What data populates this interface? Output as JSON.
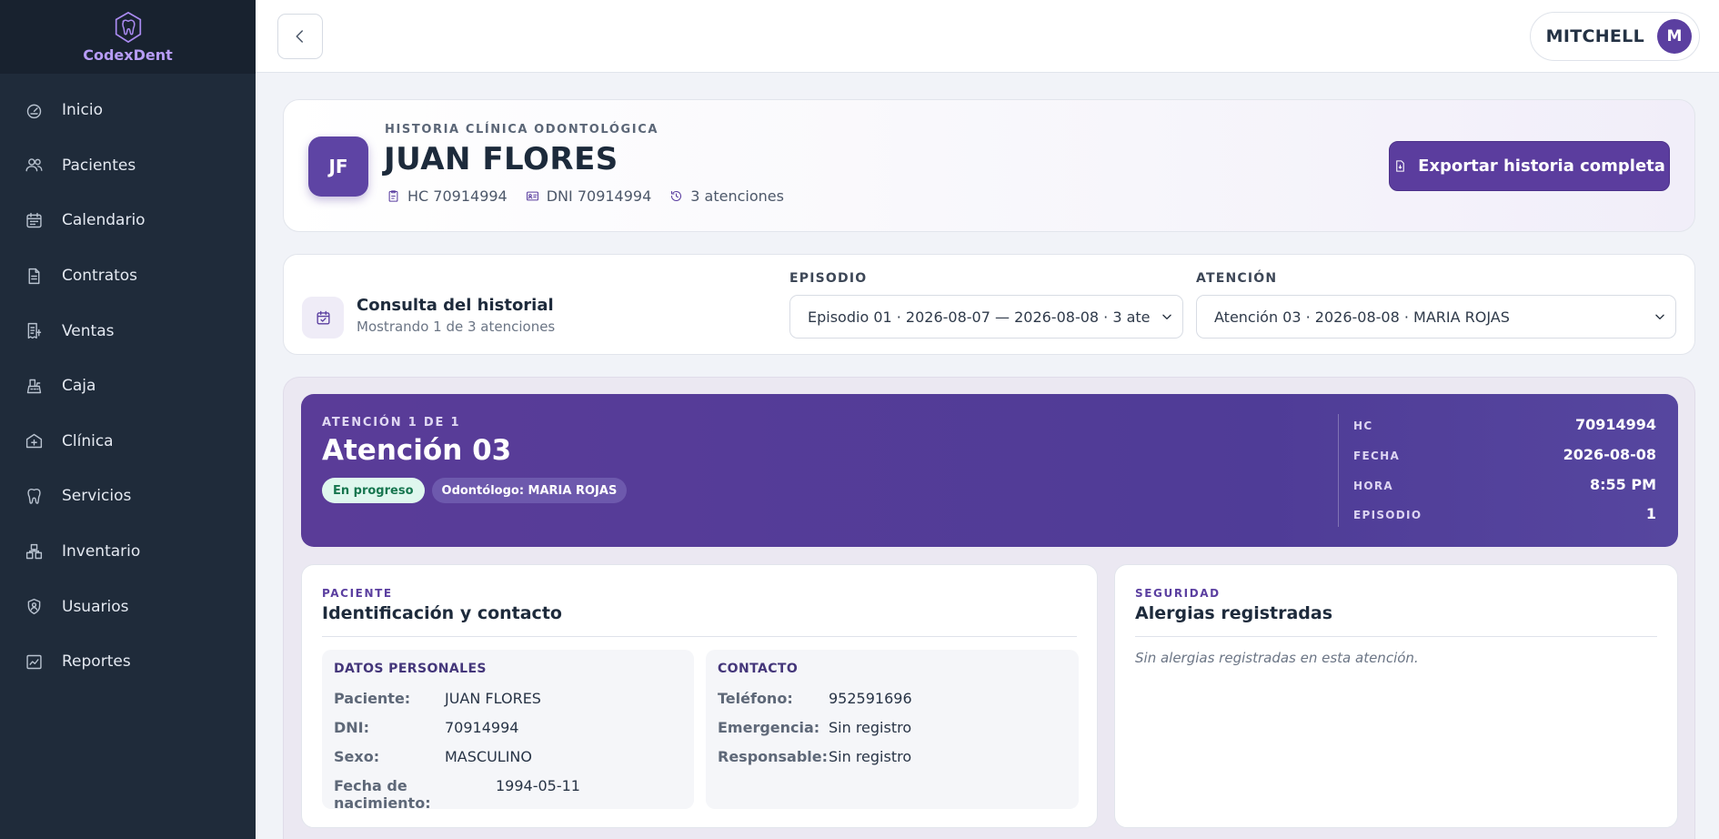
{
  "brand": {
    "name": "CodexDent",
    "logo_icon": "tooth-icon",
    "accent": "#b79cf5"
  },
  "sidebar": {
    "items": [
      {
        "label": "Inicio",
        "icon": "gauge-icon"
      },
      {
        "label": "Pacientes",
        "icon": "users-icon"
      },
      {
        "label": "Calendario",
        "icon": "calendar-icon"
      },
      {
        "label": "Contratos",
        "icon": "document-icon"
      },
      {
        "label": "Ventas",
        "icon": "receipt-icon"
      },
      {
        "label": "Caja",
        "icon": "cash-register-icon"
      },
      {
        "label": "Clínica",
        "icon": "clinic-icon"
      },
      {
        "label": "Servicios",
        "icon": "tooth-icon"
      },
      {
        "label": "Inventario",
        "icon": "boxes-icon"
      },
      {
        "label": "Usuarios",
        "icon": "user-shield-icon"
      },
      {
        "label": "Reportes",
        "icon": "chart-icon"
      }
    ]
  },
  "topbar": {
    "back_icon": "chevron-left-icon",
    "user_name": "MITCHELL",
    "user_initial": "M"
  },
  "patient": {
    "eyebrow": "HISTORIA CLÍNICA ODONTOLÓGICA",
    "initials": "JF",
    "name": "JUAN FLORES",
    "hc": "HC 70914994",
    "dni": "DNI 70914994",
    "attentions": "3 atenciones",
    "export_label": "Exportar historia completa"
  },
  "filter": {
    "title": "Consulta del historial",
    "subtitle": "Mostrando 1 de 3 atenciones",
    "episode_label": "EPISODIO",
    "episode_value": "Episodio 01 · 2026-08-07 — 2026-08-08 · 3 ate",
    "attention_label": "ATENCIÓN",
    "attention_value": "Atención 03 · 2026-08-08 · MARIA ROJAS"
  },
  "attention": {
    "eyebrow": "ATENCIÓN 1 DE 1",
    "title": "Atención 03",
    "status": "En progreso",
    "dentist": "Odontólogo: MARIA ROJAS",
    "hc_label": "HC",
    "hc_value": "70914994",
    "fecha_label": "FECHA",
    "fecha_value": "2026-08-08",
    "hora_label": "HORA",
    "hora_value": "8:55 PM",
    "episodio_label": "EPISODIO",
    "episodio_value": "1"
  },
  "patient_panel": {
    "eyebrow": "PACIENTE",
    "title": "Identificación y contacto",
    "personal": {
      "title": "DATOS PERSONALES",
      "rows": [
        {
          "k": "Paciente:",
          "v": "JUAN FLORES"
        },
        {
          "k": "DNI:",
          "v": "70914994"
        },
        {
          "k": "Sexo:",
          "v": "MASCULINO"
        },
        {
          "k": "Fecha de nacimiento:",
          "v": "1994-05-11"
        }
      ]
    },
    "contact": {
      "title": "CONTACTO",
      "rows": [
        {
          "k": "Teléfono:",
          "v": "952591696"
        },
        {
          "k": "Emergencia:",
          "v": "Sin registro"
        },
        {
          "k": "Responsable:",
          "v": "Sin registro"
        }
      ]
    }
  },
  "safety_panel": {
    "eyebrow": "SEGURIDAD",
    "title": "Alergias registradas",
    "empty": "Sin alergias registradas en esta atención."
  }
}
